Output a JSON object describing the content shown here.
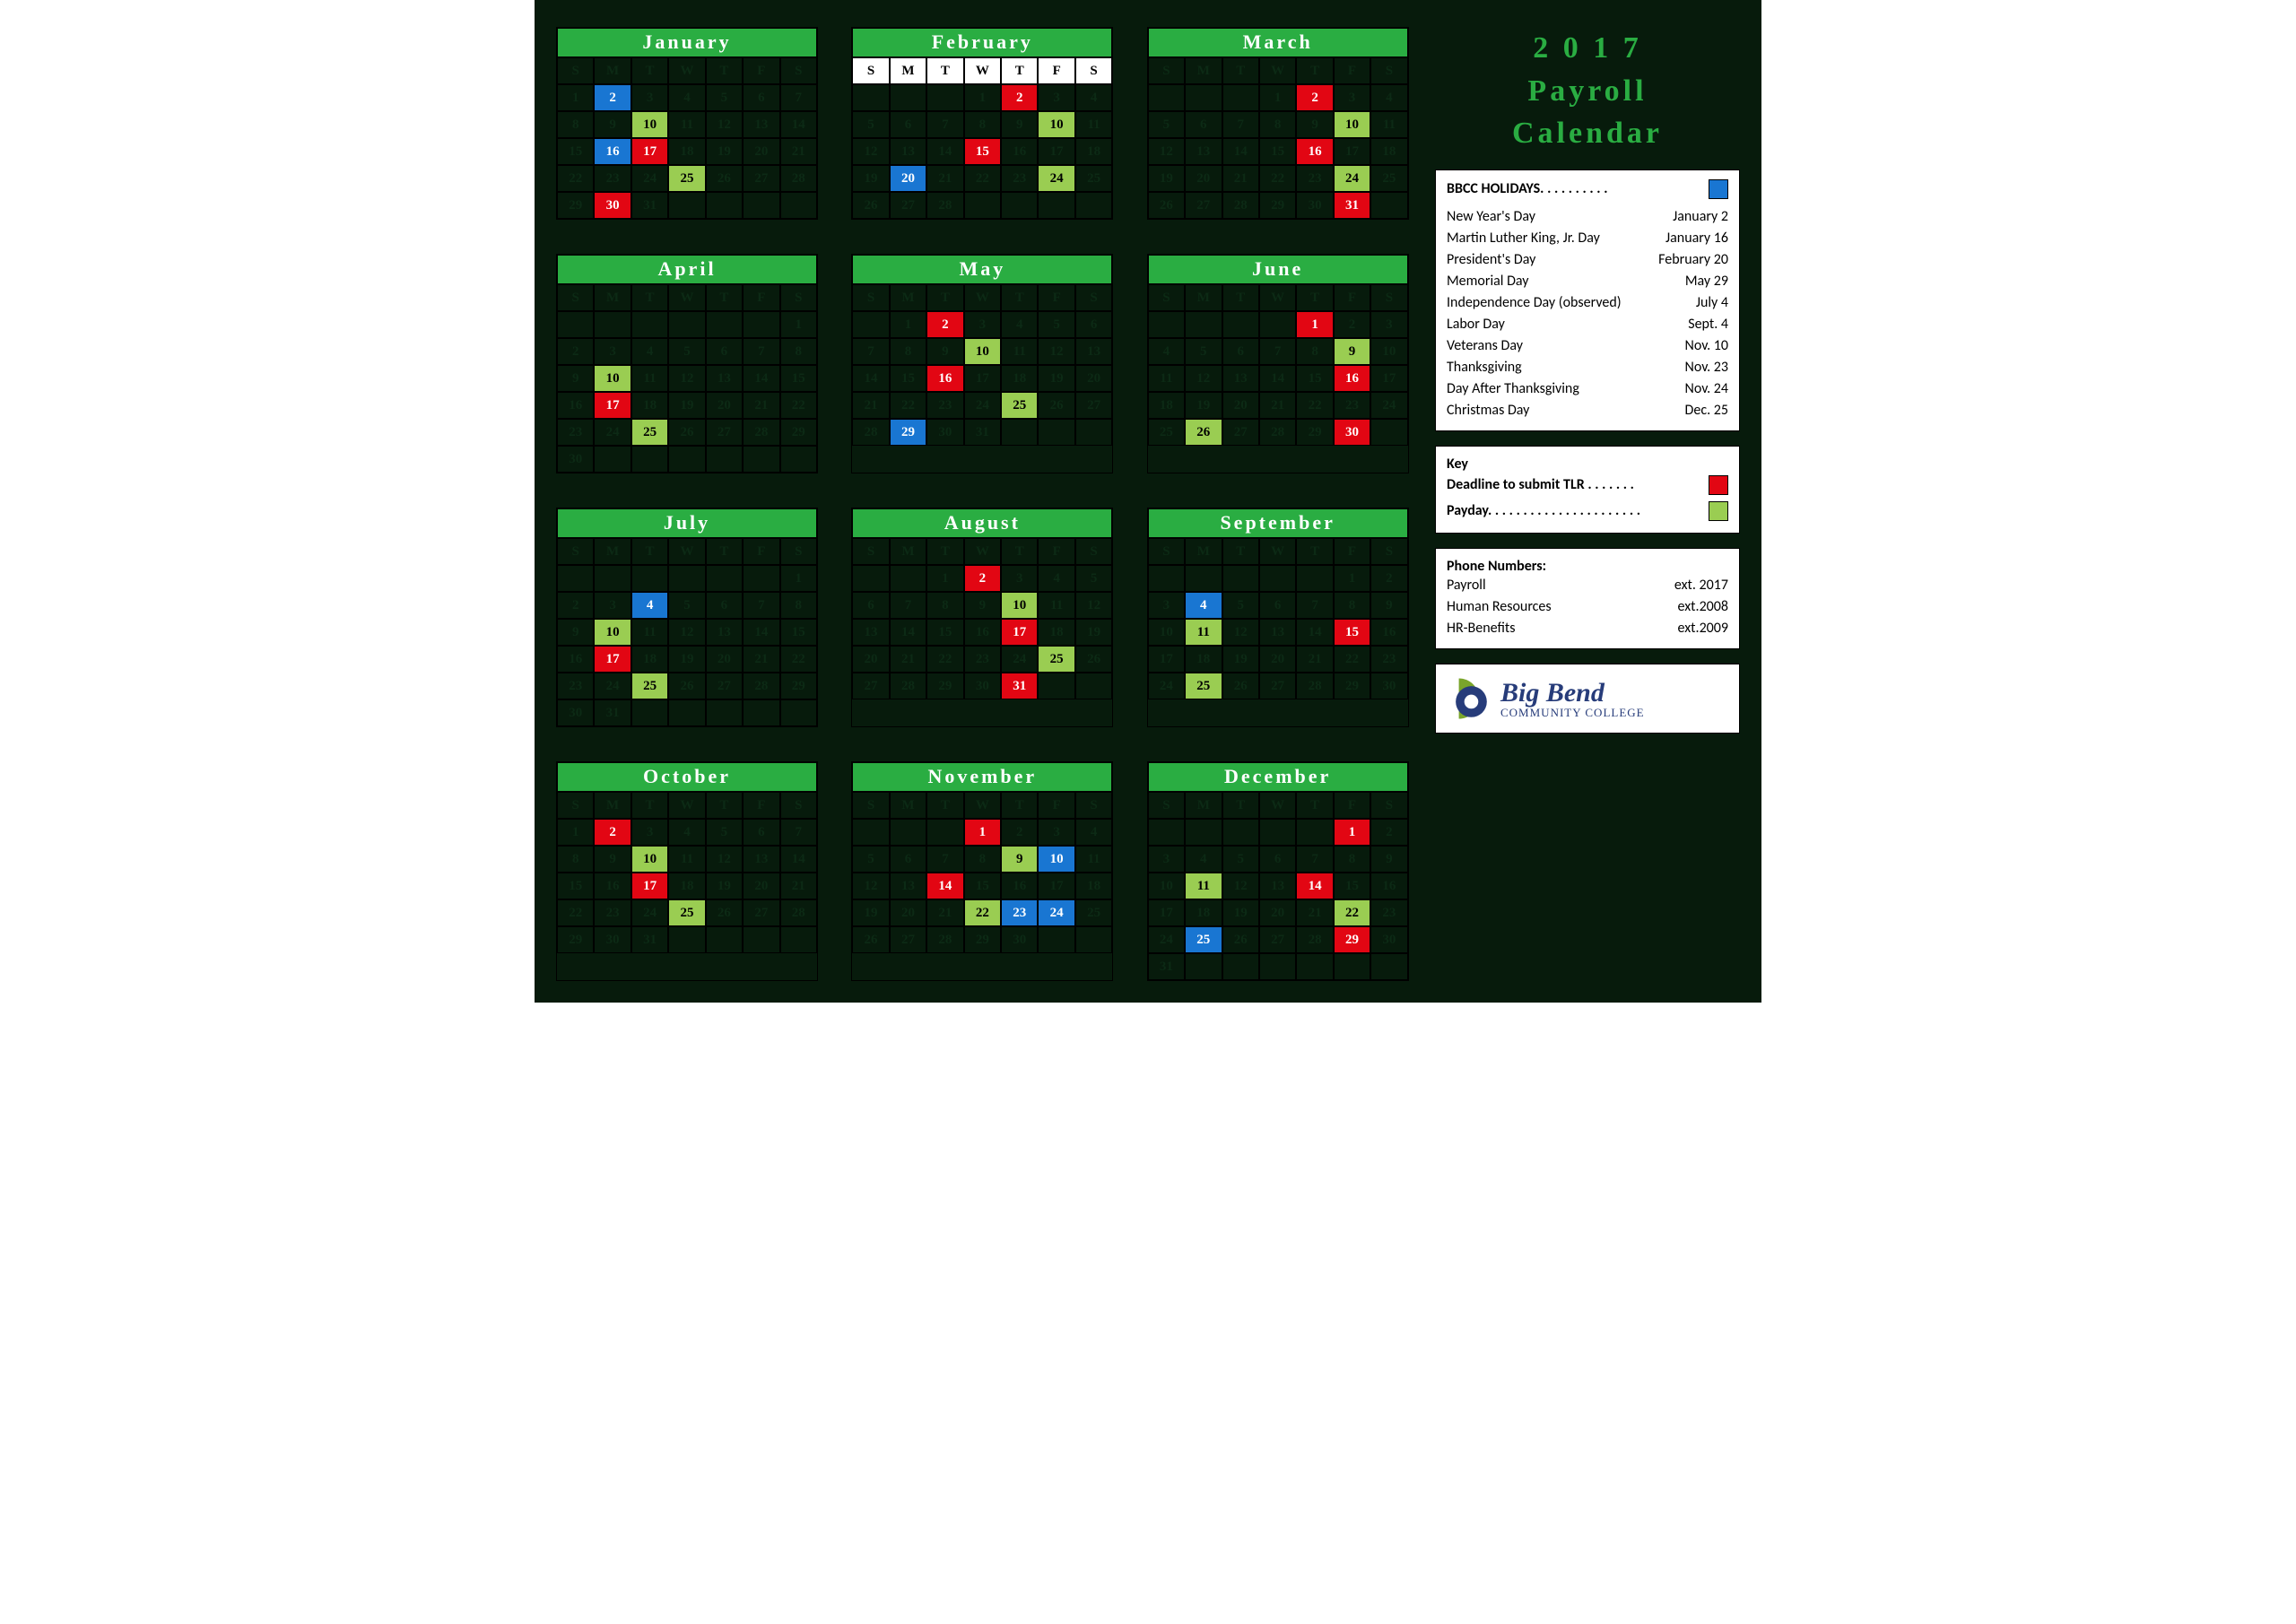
{
  "title": {
    "line1": "2 0 1 7",
    "line2": "Payroll",
    "line3": "Calendar"
  },
  "dow": [
    "S",
    "M",
    "T",
    "W",
    "T",
    "F",
    "S"
  ],
  "months": [
    {
      "name": "January",
      "startDay": 0,
      "daysInMonth": 31,
      "whiteHeader": false,
      "marks": {
        "2": "blue",
        "10": "green",
        "16": "blue",
        "17": "red",
        "25": "green",
        "30": "red"
      }
    },
    {
      "name": "February",
      "startDay": 3,
      "daysInMonth": 28,
      "whiteHeader": true,
      "marks": {
        "2": "red",
        "10": "green",
        "15": "red",
        "20": "blue",
        "24": "green"
      }
    },
    {
      "name": "March",
      "startDay": 3,
      "daysInMonth": 31,
      "whiteHeader": false,
      "marks": {
        "2": "red",
        "10": "green",
        "16": "red",
        "24": "green",
        "31": "red"
      }
    },
    {
      "name": "April",
      "startDay": 6,
      "daysInMonth": 30,
      "whiteHeader": false,
      "marks": {
        "10": "green",
        "17": "red",
        "25": "green"
      }
    },
    {
      "name": "May",
      "startDay": 1,
      "daysInMonth": 31,
      "whiteHeader": false,
      "marks": {
        "2": "red",
        "10": "green",
        "16": "red",
        "25": "green",
        "29": "blue"
      }
    },
    {
      "name": "June",
      "startDay": 4,
      "daysInMonth": 30,
      "whiteHeader": false,
      "marks": {
        "1": "red",
        "9": "green",
        "16": "red",
        "26": "green",
        "30": "red"
      }
    },
    {
      "name": "July",
      "startDay": 6,
      "daysInMonth": 31,
      "whiteHeader": false,
      "marks": {
        "4": "blue",
        "10": "green",
        "17": "red",
        "25": "green"
      }
    },
    {
      "name": "August",
      "startDay": 2,
      "daysInMonth": 31,
      "whiteHeader": false,
      "marks": {
        "2": "red",
        "10": "green",
        "17": "red",
        "25": "green",
        "31": "red"
      }
    },
    {
      "name": "September",
      "startDay": 5,
      "daysInMonth": 30,
      "whiteHeader": false,
      "marks": {
        "4": "blue",
        "11": "green",
        "15": "red",
        "25": "green"
      }
    },
    {
      "name": "October",
      "startDay": 0,
      "daysInMonth": 31,
      "whiteHeader": false,
      "marks": {
        "2": "red",
        "10": "green",
        "17": "red",
        "25": "green"
      }
    },
    {
      "name": "November",
      "startDay": 3,
      "daysInMonth": 30,
      "whiteHeader": false,
      "marks": {
        "1": "red",
        "9": "green",
        "10": "blue",
        "14": "red",
        "22": "green",
        "23": "blue",
        "24": "blue"
      }
    },
    {
      "name": "December",
      "startDay": 5,
      "daysInMonth": 31,
      "whiteHeader": false,
      "marks": {
        "1": "red",
        "11": "green",
        "14": "red",
        "22": "green",
        "25": "blue",
        "29": "red"
      }
    }
  ],
  "holidays": {
    "header": "BBCC HOLIDAYS. . . . . . . . . .",
    "items": [
      {
        "name": "New Year's Day",
        "date": "January 2"
      },
      {
        "name": "Martin Luther King, Jr. Day",
        "date": "January 16"
      },
      {
        "name": "President's Day",
        "date": "February 20"
      },
      {
        "name": "Memorial Day",
        "date": "May 29"
      },
      {
        "name": "Independence Day (observed)",
        "date": "July 4"
      },
      {
        "name": "Labor Day",
        "date": "Sept. 4"
      },
      {
        "name": "Veterans Day",
        "date": "Nov. 10"
      },
      {
        "name": "Thanksgiving",
        "date": "Nov. 23"
      },
      {
        "name": "Day After Thanksgiving",
        "date": "Nov. 24"
      },
      {
        "name": "Christmas Day",
        "date": "Dec. 25"
      }
    ]
  },
  "key": {
    "header": "Key",
    "tlr": "Deadline to submit TLR . . . . . . .",
    "payday": "Payday. . . . . . . . . . . . . . . . . . . . . ."
  },
  "phones": {
    "header": "Phone Numbers:",
    "items": [
      {
        "name": "Payroll",
        "ext": "ext. 2017"
      },
      {
        "name": "Human Resources",
        "ext": "ext.2008"
      },
      {
        "name": "HR-Benefits",
        "ext": "ext.2009"
      }
    ]
  },
  "logo": {
    "line1": "Big Bend",
    "line2": "COMMUNITY COLLEGE"
  }
}
